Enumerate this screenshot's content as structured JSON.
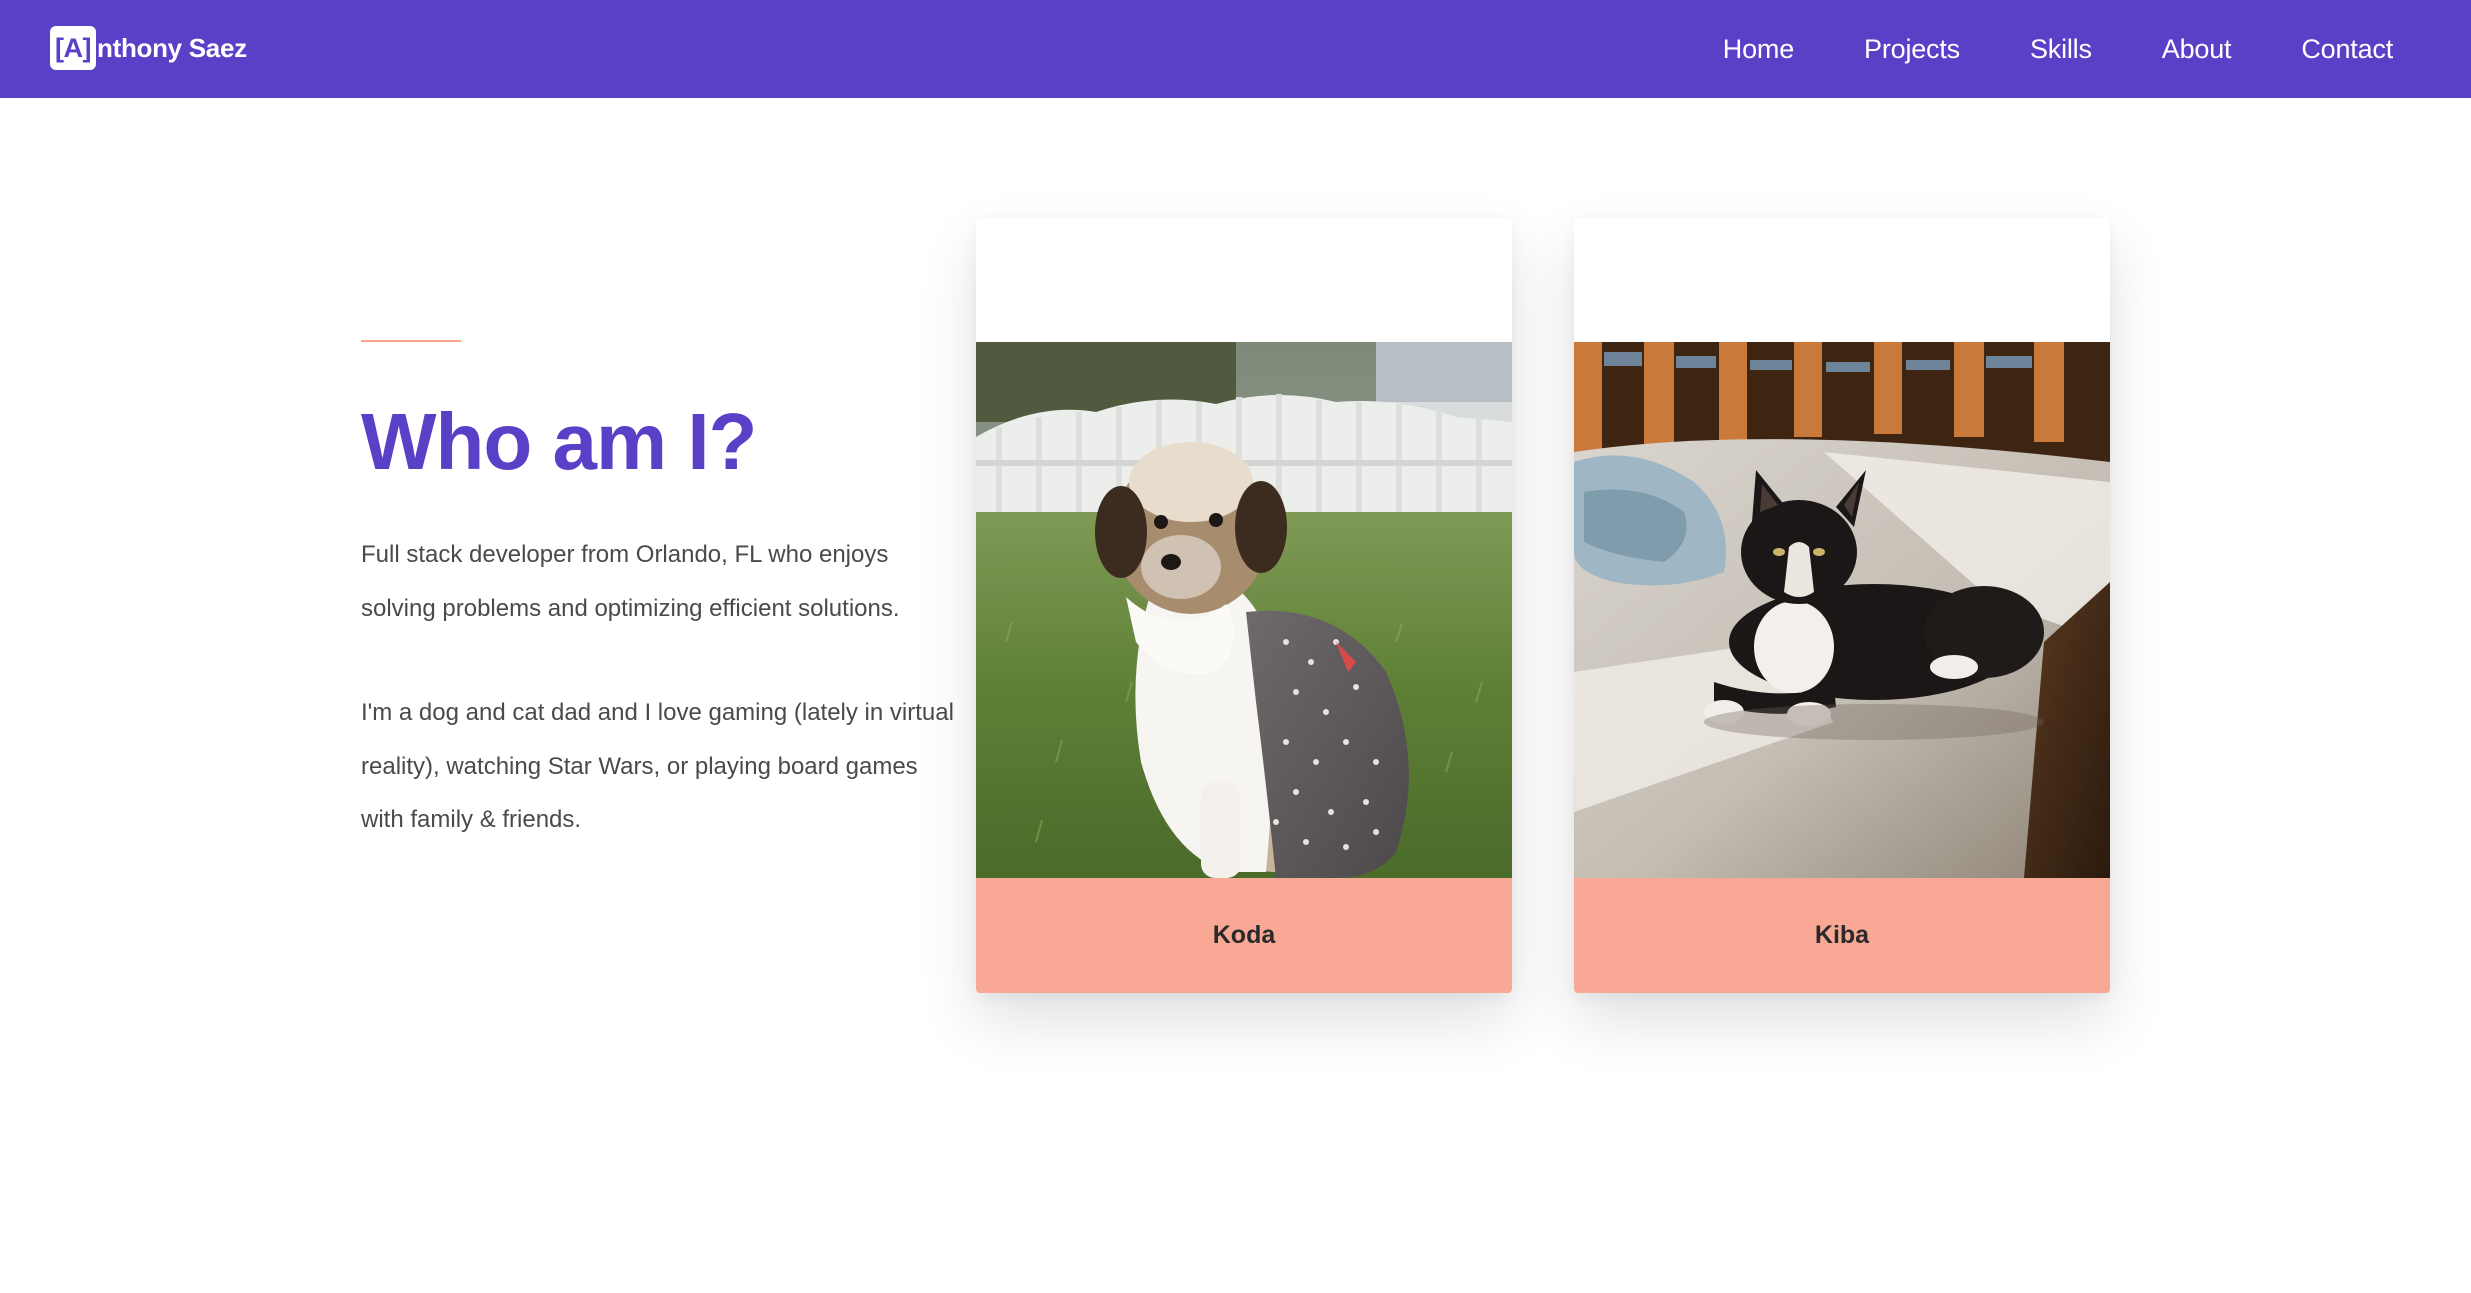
{
  "header": {
    "brand_mark": "[A]",
    "brand_rest": "nthony Saez",
    "background_color": "#5a40c6",
    "nav": [
      {
        "label": "Home"
      },
      {
        "label": "Projects"
      },
      {
        "label": "Skills"
      },
      {
        "label": "About"
      },
      {
        "label": "Contact"
      }
    ]
  },
  "about": {
    "title": "Who am I?",
    "paragraph_1": "Full stack developer from Orlando, FL who enjoys solving problems and optimizing efficient solutions.",
    "paragraph_2": "I'm a dog and cat dad and I love gaming (lately in virtual reality), watching Star Wars, or playing board games with family & friends.",
    "accent_color": "#5a40c6",
    "line_color": "#f7a58b"
  },
  "pets": [
    {
      "name": "Koda",
      "photo": "dog-photo",
      "label_color": "#f9a895"
    },
    {
      "name": "Kiba",
      "photo": "cat-photo",
      "label_color": "#f9a895"
    }
  ]
}
